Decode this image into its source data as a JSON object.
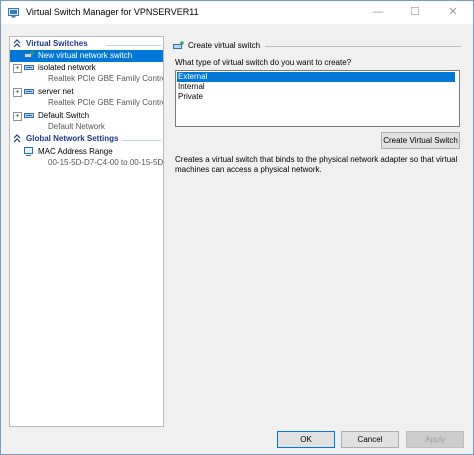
{
  "window": {
    "title": "Virtual Switch Manager for VPNSERVER11",
    "minimize_glyph": "—",
    "maximize_glyph": "☐",
    "close_glyph": "✕"
  },
  "left_pane": {
    "virtual_switches_header": "Virtual Switches",
    "items": [
      {
        "label": "New virtual network switch",
        "selected": true
      },
      {
        "label": "isolated network",
        "sub": "Realtek PCIe GBE Family Controller",
        "expandable": true
      },
      {
        "label": "server net",
        "sub": "Realtek PCIe GBE Family Controller",
        "expandable": true
      },
      {
        "label": "Default Switch",
        "sub": "Default Network",
        "expandable": true
      }
    ],
    "global_header": "Global Network Settings",
    "mac": {
      "label": "MAC Address Range",
      "sub": "00-15-5D-D7-C4-00 to 00-15-5D-D..."
    }
  },
  "right_pane": {
    "group_title": "Create virtual switch",
    "question": "What type of virtual switch do you want to create?",
    "options": [
      "External",
      "Internal",
      "Private"
    ],
    "selected_option": "External",
    "create_button": "Create Virtual Switch",
    "description": "Creates a virtual switch that binds to the physical network adapter so that virtual machines can access a physical network."
  },
  "buttons": {
    "ok": "OK",
    "cancel": "Cancel",
    "apply": "Apply"
  },
  "colors": {
    "selection": "#0078d7",
    "section_header": "#1e3a8a"
  },
  "icons": {
    "app": "virtual-switch-manager-icon",
    "collapse": "double-chevron-up-icon",
    "switch": "network-switch-icon",
    "new_switch": "add-switch-icon",
    "mac": "network-settings-icon"
  }
}
